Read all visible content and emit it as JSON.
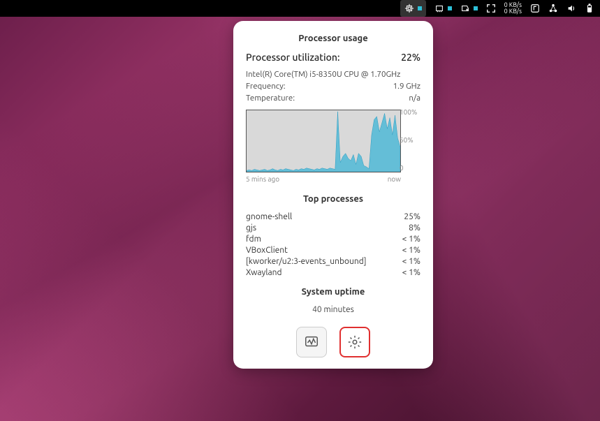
{
  "topbar": {
    "netspeed_down": "0 KB/s",
    "netspeed_up": "0 KB/s"
  },
  "popup": {
    "title_processor": "Processor usage",
    "utilization_label": "Processor utilization:",
    "utilization_value": "22%",
    "cpu_model": "Intel(R) Core(TM) i5-8350U CPU @ 1.70GHz",
    "frequency_label": "Frequency:",
    "frequency_value": "1.9 GHz",
    "temperature_label": "Temperature:",
    "temperature_value": "n/a",
    "chart_y_100": "100%",
    "chart_y_50": "50%",
    "chart_y_0": "0",
    "chart_x_start": "5 mins ago",
    "chart_x_end": "now",
    "title_top_processes": "Top processes",
    "processes": [
      {
        "name": "gnome-shell",
        "pct": "25%"
      },
      {
        "name": "gjs",
        "pct": "8%"
      },
      {
        "name": "fdm",
        "pct": "< 1%"
      },
      {
        "name": "VBoxClient",
        "pct": "< 1%"
      },
      {
        "name": "[kworker/u2:3-events_unbound]",
        "pct": "< 1%"
      },
      {
        "name": "Xwayland",
        "pct": "< 1%"
      }
    ],
    "title_uptime": "System uptime",
    "uptime_value": "40 minutes"
  },
  "chart_data": {
    "type": "area",
    "title": "Processor usage",
    "xlabel": "",
    "ylabel": "",
    "ylim": [
      0,
      100
    ],
    "x_range": [
      "5 mins ago",
      "now"
    ],
    "values": [
      2,
      3,
      2,
      4,
      3,
      2,
      3,
      4,
      2,
      3,
      5,
      3,
      2,
      4,
      3,
      5,
      4,
      3,
      2,
      4,
      3,
      5,
      4,
      6,
      5,
      4,
      3,
      5,
      4,
      6,
      5,
      4,
      6,
      5,
      4,
      98,
      15,
      25,
      30,
      22,
      18,
      28,
      12,
      30,
      25,
      10,
      8,
      5,
      60,
      85,
      90,
      65,
      80,
      95,
      70,
      88,
      60,
      92,
      55,
      40
    ]
  }
}
